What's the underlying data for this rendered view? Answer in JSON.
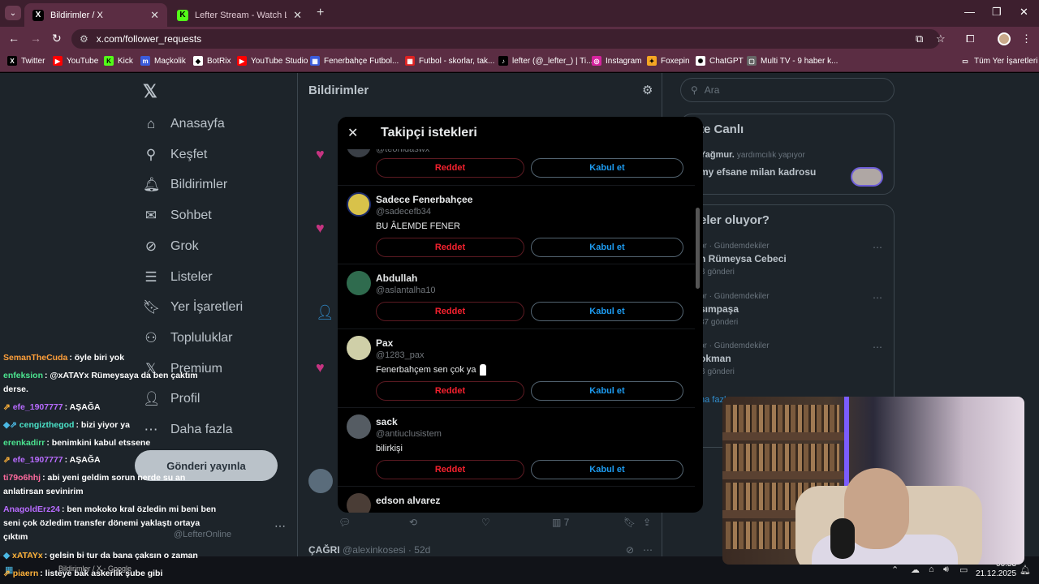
{
  "browser": {
    "tabs": [
      {
        "label": "Bildirimler / X",
        "active": true
      },
      {
        "label": "Lefter Stream - Watch Live on K",
        "active": false
      }
    ],
    "url": "x.com/follower_requests",
    "bookmarks": [
      "Twitter",
      "YouTube",
      "Kick",
      "Maçkolik",
      "BotRix",
      "YouTube Studio",
      "Fenerbahçe Futbol...",
      "Futbol - skorlar, tak...",
      "lefter (@_lefter_) | Ti...",
      "Instagram",
      "Foxepin",
      "ChatGPT",
      "Multi TV - 9 haber k..."
    ],
    "all_bookmarks": "Tüm Yer İşaretleri"
  },
  "sidebar": {
    "items": [
      {
        "label": "Anasayfa",
        "icon": "home-icon"
      },
      {
        "label": "Keşfet",
        "icon": "search-icon"
      },
      {
        "label": "Bildirimler",
        "icon": "bell-icon"
      },
      {
        "label": "Sohbet",
        "icon": "mail-icon"
      },
      {
        "label": "Grok",
        "icon": "grok-icon"
      },
      {
        "label": "Listeler",
        "icon": "list-icon"
      },
      {
        "label": "Yer İşaretleri",
        "icon": "bookmark-icon"
      },
      {
        "label": "Topluluklar",
        "icon": "community-icon"
      },
      {
        "label": "Premium",
        "icon": "x-premium-icon"
      },
      {
        "label": "Profil",
        "icon": "profile-icon"
      },
      {
        "label": "Daha fazla",
        "icon": "more-icon"
      }
    ],
    "post_button": "Gönderi yayınla",
    "account_handle": "@LefterOnline"
  },
  "center": {
    "title": "Bildirimler",
    "action_count": "7",
    "footer_tweet": {
      "name": "ÇAĞRI",
      "handle": "@alexinkosesi",
      "time": "52d"
    }
  },
  "right": {
    "search_placeholder": "Ara",
    "live_title": "te Canlı",
    "live_user": "Yağmur.",
    "live_status": "yardımcılık yapıyor",
    "live_text": "my efsane milan kadrosu",
    "trends_title": "eler oluyor?",
    "trends": [
      {
        "meta": "or · Gündemdekiler",
        "name": "n Rümeysa Cebeci",
        "count": "B gönderi"
      },
      {
        "meta": "or · Gündemdekiler",
        "name": "sımpaşa",
        "count": "37 gönderi"
      },
      {
        "meta": "or · Gündemdekiler",
        "name": "okman",
        "count": "B gönderi"
      }
    ],
    "show_more": "ha fazla"
  },
  "modal": {
    "title": "Takipçi istekleri",
    "reject_label": "Reddet",
    "accept_label": "Kabul et",
    "requests": [
      {
        "name": "",
        "handle": "@teonidaswx",
        "bio": "",
        "avatar_color": "#3a3f46"
      },
      {
        "name": "Sadece Fenerbahçee",
        "handle": "@sadecefb34",
        "bio": "BU ÂLEMDE FENER",
        "avatar_color": "#d8c24a"
      },
      {
        "name": "Abdullah",
        "handle": "@aslantalha10",
        "bio": "",
        "avatar_color": "#2f6b4e"
      },
      {
        "name": "Pax",
        "handle": "@1283_pax",
        "bio": "Fenerbahçem sen çok ya",
        "avatar_color": "#cfcfa8"
      },
      {
        "name": "sack",
        "handle": "@antiuclusistem",
        "bio": "bilirkişi",
        "avatar_color": "#555c63"
      },
      {
        "name": "edson alvarez",
        "handle": "",
        "bio": "",
        "avatar_color": "#4a3d36"
      }
    ]
  },
  "chat": [
    {
      "user": "SemanTheCuda",
      "text": ": öyle biri yok",
      "color": "#ff9f3a"
    },
    {
      "user": "enfeksion",
      "text": ": @xATAYx Rümeysaya da ben çaktım derse.",
      "color": "#4be38f"
    },
    {
      "user": "efe_1907777",
      "text": ": AŞAĞA",
      "color": "#b86bff"
    },
    {
      "user": "cengizthegod",
      "text": ": bizi yiyor ya",
      "color": "#4be3c8"
    },
    {
      "user": "erenkadirr",
      "text": ": benimkini kabul etssene",
      "color": "#4be38f"
    },
    {
      "user": "efe_1907777",
      "text": ": AŞAĞA",
      "color": "#b86bff"
    },
    {
      "user": "ti79o6hhj",
      "text": ": abi yeni geldim sorun nerde su an anlatirsan sevinirim",
      "color": "#ff6a9f"
    },
    {
      "user": "AnagoldErz24",
      "text": ": ben mokoko kral özledin mi beni ben seni çok özledim transfer dönemi yaklaştı ortaya çıktım",
      "color": "#b86bff"
    },
    {
      "user": "xATAYx",
      "text": ": gelsin bi tur da bana çaksın o zaman",
      "color": "#ffb23a"
    },
    {
      "user": "piaern",
      "text": ": listeye bak askerlik şube gibi",
      "color": "#ffb23a"
    }
  ],
  "taskbar": {
    "time": "00:53",
    "date": "21.12.2025",
    "bottom_label": "Bildirimler / X - Google"
  }
}
